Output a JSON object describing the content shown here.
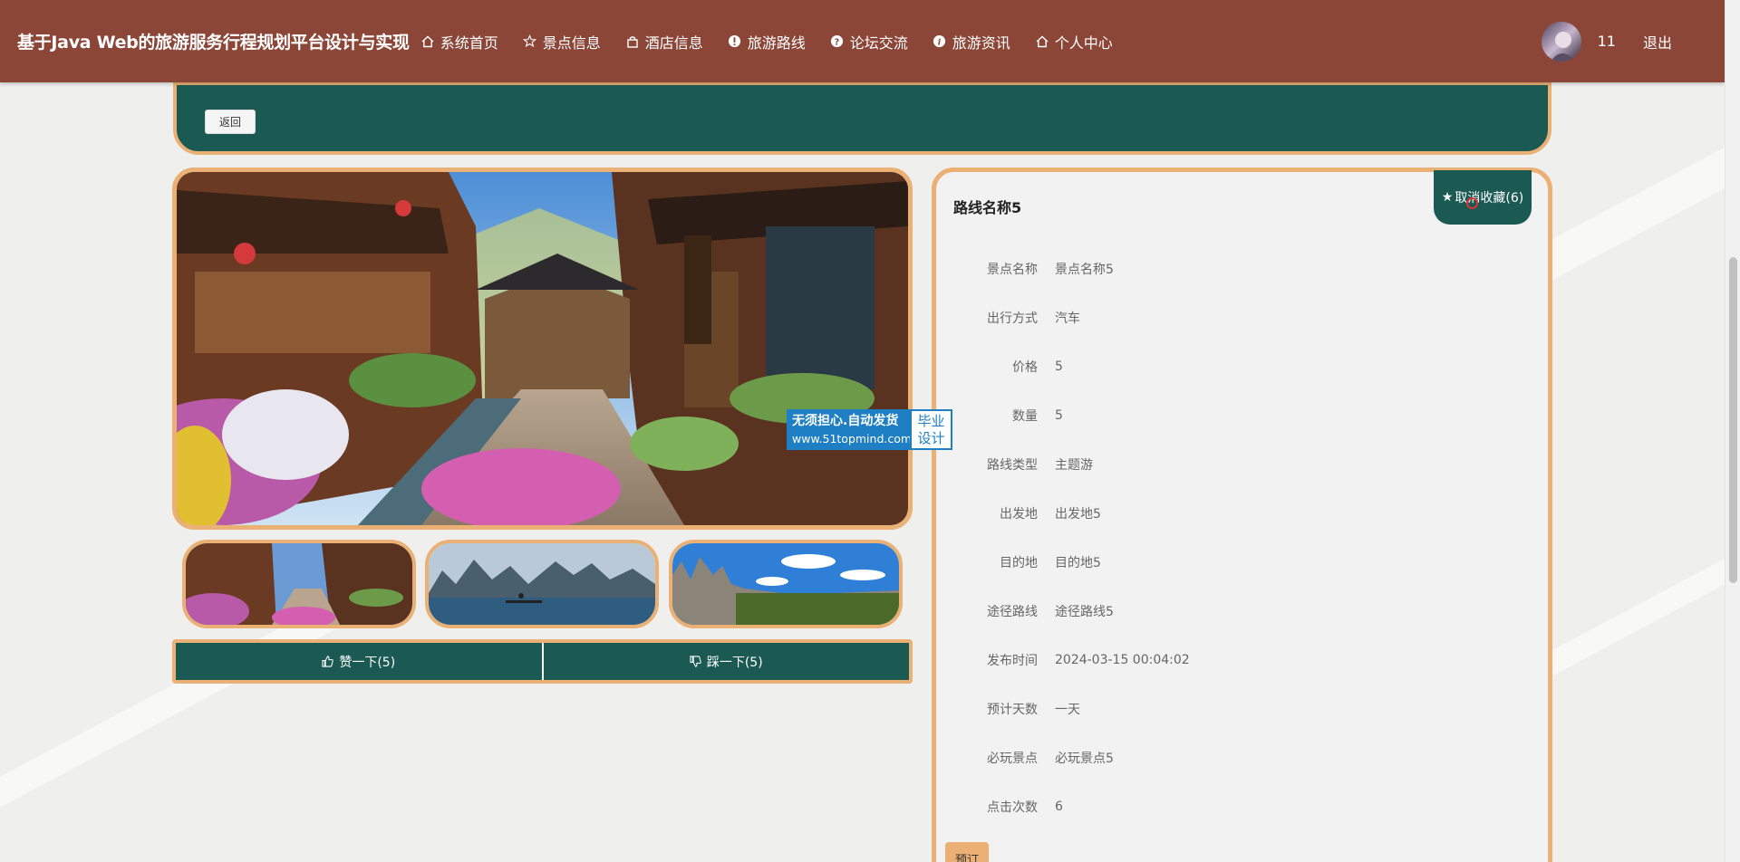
{
  "header": {
    "site_title": "基于Java Web的旅游服务行程规划平台设计与实现",
    "nav": [
      {
        "label": "系统首页",
        "icon": "home-icon"
      },
      {
        "label": "景点信息",
        "icon": "star-icon"
      },
      {
        "label": "酒店信息",
        "icon": "bag-icon"
      },
      {
        "label": "旅游路线",
        "icon": "alert-icon"
      },
      {
        "label": "论坛交流",
        "icon": "question-icon"
      },
      {
        "label": "旅游资讯",
        "icon": "info-icon"
      },
      {
        "label": "个人中心",
        "icon": "home-icon"
      }
    ],
    "user_id": "11",
    "logout_label": "退出"
  },
  "back_label": "返回",
  "gallery": {
    "vote_up_label": "赞一下(5)",
    "vote_down_label": "踩一下(5)"
  },
  "watermark": {
    "line1": "无须担心.自动发货",
    "line2": "www.51topmind.com",
    "right_top": "毕业",
    "right_bottom": "设计"
  },
  "detail": {
    "title": "路线名称5",
    "favorite_label": "取消收藏(6)",
    "fields": [
      {
        "label": "景点名称",
        "value": "景点名称5"
      },
      {
        "label": "出行方式",
        "value": "汽车"
      },
      {
        "label": "价格",
        "value": "5"
      },
      {
        "label": "数量",
        "value": "5"
      },
      {
        "label": "路线类型",
        "value": "主题游"
      },
      {
        "label": "出发地",
        "value": "出发地5"
      },
      {
        "label": "目的地",
        "value": "目的地5"
      },
      {
        "label": "途径路线",
        "value": "途径路线5"
      },
      {
        "label": "发布时间",
        "value": "2024-03-15 00:04:02"
      },
      {
        "label": "预计天数",
        "value": "一天"
      },
      {
        "label": "必玩景点",
        "value": "必玩景点5"
      },
      {
        "label": "点击次数",
        "value": "6"
      }
    ],
    "book_label": "预订"
  },
  "colors": {
    "header_bg": "#8b4638",
    "teal": "#1b5a53",
    "accent_border": "#eab074",
    "page_bg": "#efefed"
  }
}
